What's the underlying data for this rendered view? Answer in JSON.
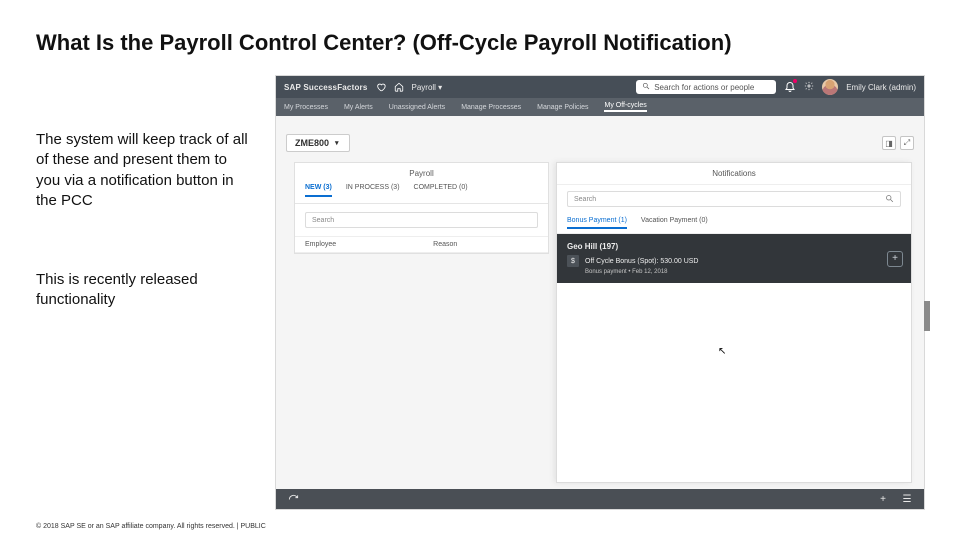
{
  "slide": {
    "title": "What Is the Payroll Control Center? (Off-Cycle Payroll Notification)",
    "para1": "The system will keep track of all of these and present them to you via a notification button in the PCC",
    "para2": "This is recently released functionality",
    "footer": "© 2018 SAP SE or an SAP affiliate company. All rights reserved.  |  PUBLIC"
  },
  "topbar": {
    "brand": "SAP SuccessFactors",
    "menu": "Payroll",
    "search_placeholder": "Search for actions or people",
    "user": "Emily Clark (admin)"
  },
  "navtabs": [
    "My Processes",
    "My Alerts",
    "Unassigned Alerts",
    "Manage Processes",
    "Manage Policies",
    "My Off-cycles"
  ],
  "period": "ZME800",
  "card": {
    "title": "Payroll",
    "tabs": [
      "NEW (3)",
      "IN PROCESS (3)",
      "COMPLETED (0)"
    ],
    "search": "Search",
    "col1": "Employee",
    "col2": "Reason"
  },
  "notif": {
    "title": "Notifications",
    "search": "Search",
    "tabs": [
      "Bonus Payment (1)",
      "Vacation Payment (0)"
    ],
    "name": "Geo Hill (197)",
    "line1": "Off Cycle Bonus (Spot): 530.00 USD",
    "line2": "Bonus payment  •  Feb 12, 2018"
  }
}
